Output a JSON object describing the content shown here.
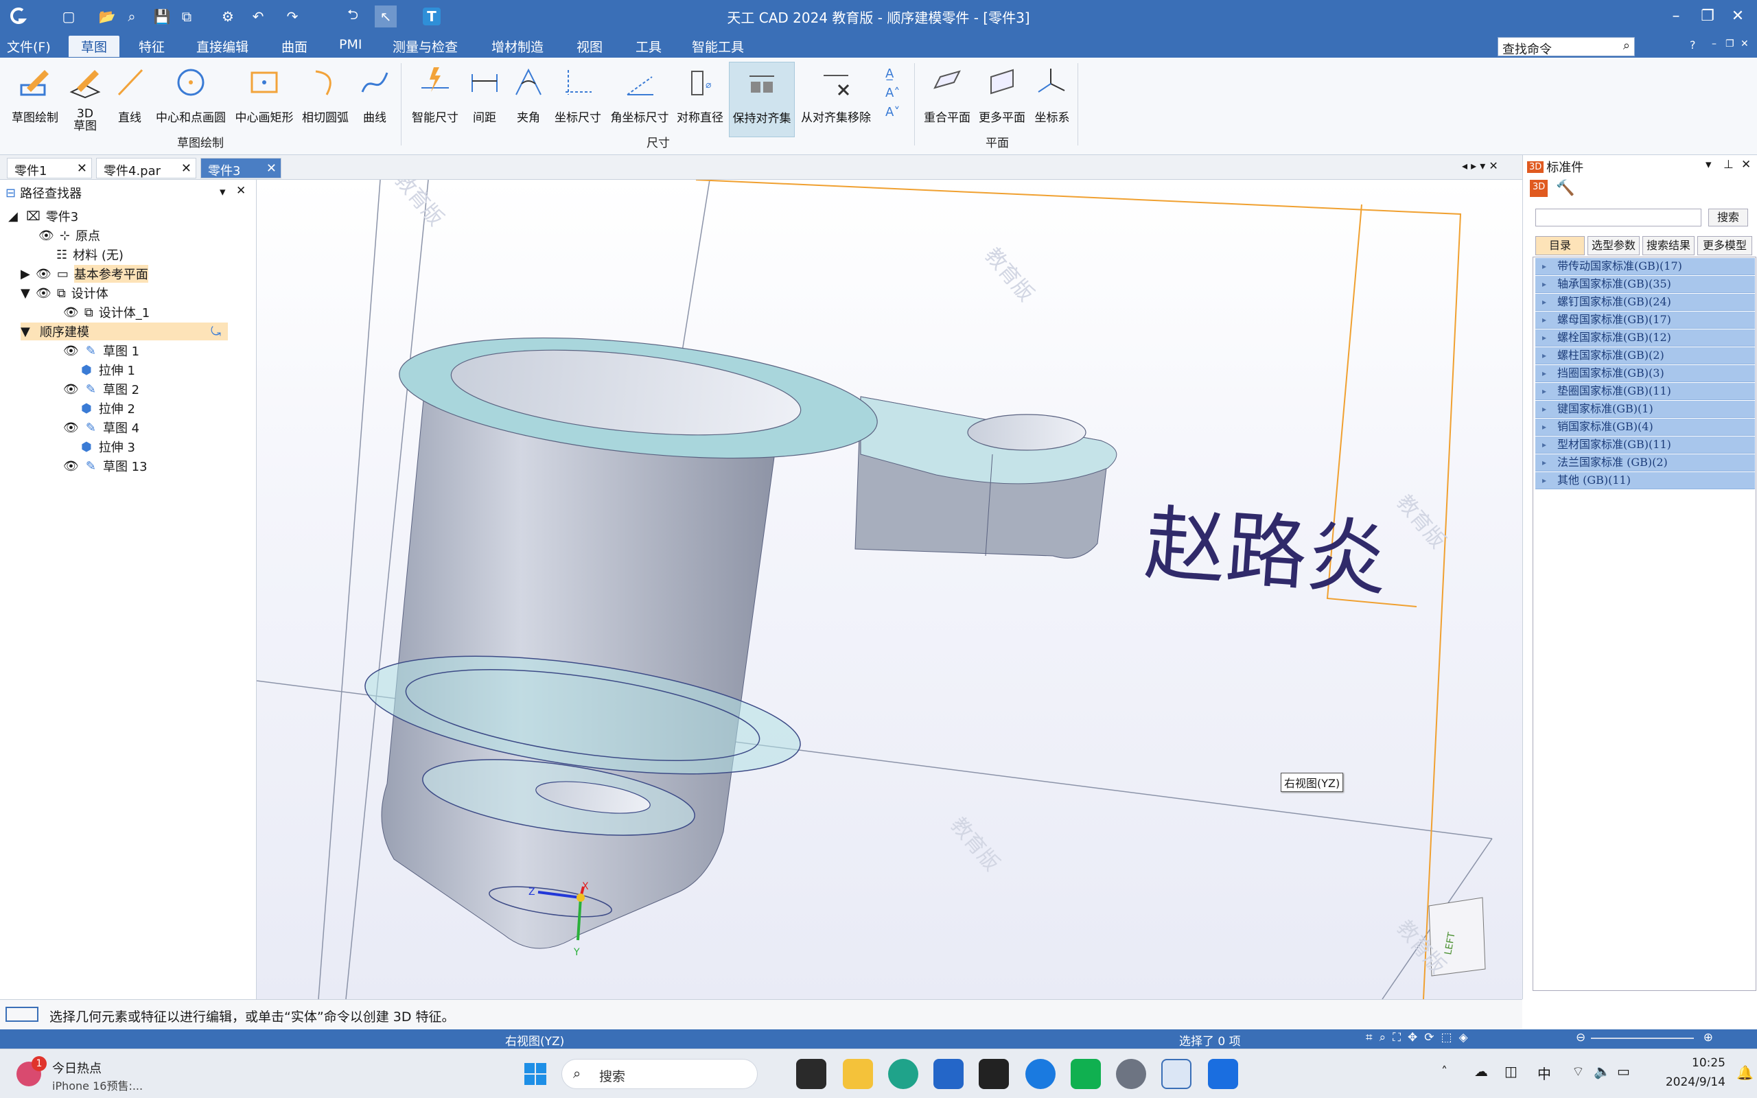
{
  "window": {
    "title": "天工 CAD 2024 教育版 - 顺序建模零件 - [零件3]"
  },
  "menubar": {
    "items": [
      "文件(F)",
      "草图",
      "特征",
      "直接编辑",
      "曲面",
      "PMI",
      "测量与检查",
      "增材制造",
      "视图",
      "工具",
      "智能工具"
    ],
    "active": "草图",
    "search_value": "查找命令",
    "help": "?"
  },
  "ribbon": {
    "sketch_group": {
      "label": "草图绘制",
      "buttons": [
        "草图绘制",
        "3D 草图",
        "直线",
        "中心和点画圆",
        "中心画矩形",
        "相切圆弧",
        "曲线"
      ]
    },
    "dimension_group": {
      "label": "尺寸",
      "buttons": [
        "智能尺寸",
        "间距",
        "夹角",
        "坐标尺寸",
        "角坐标尺寸",
        "对称直径",
        "保持对齐集",
        "从对齐集移除"
      ]
    },
    "plane_group": {
      "label": "平面",
      "buttons": [
        "重合平面",
        "更多平面",
        "坐标系"
      ]
    }
  },
  "doc_tabs": [
    "零件1",
    "零件4.par",
    "零件3"
  ],
  "active_tab": "零件3",
  "pathfinder": {
    "title": "路径查找器",
    "items": [
      "零件3",
      "原点",
      "材料 (无)",
      "基本参考平面",
      "设计体",
      "设计体_1",
      "顺序建模",
      "草图 1",
      "拉伸 1",
      "草图 2",
      "拉伸 2",
      "草图 4",
      "拉伸 3",
      "草图 13"
    ]
  },
  "viewport": {
    "annotation_text": "赵路炎",
    "view_label": "右视图(YZ)",
    "watermark": "教育版",
    "axis_labels": {
      "x": "X",
      "y": "Y",
      "z": "Z"
    },
    "cube_label": "LEFT"
  },
  "right_panel": {
    "title": "标准件",
    "search_button": "搜索",
    "tabs": [
      "目录",
      "选型参数",
      "搜索结果",
      "更多模型"
    ],
    "standards": [
      "带传动国家标准(GB)(17)",
      "轴承国家标准(GB)(35)",
      "螺钉国家标准(GB)(24)",
      "螺母国家标准(GB)(17)",
      "螺栓国家标准(GB)(12)",
      "螺柱国家标准(GB)(2)",
      "挡圈国家标准(GB)(3)",
      "垫圈国家标准(GB)(11)",
      "键国家标准(GB)(1)",
      "销国家标准(GB)(4)",
      "型材国家标准(GB)(11)",
      "法兰国家标准 (GB)(2)",
      "其他 (GB)(11)"
    ]
  },
  "status": {
    "prompt": "选择几何元素或特征以进行编辑，或单击“实体”命令以创建 3D 特征。",
    "view_name": "右视图(YZ)",
    "selection": "选择了 0 项"
  },
  "taskbar": {
    "news_title": "今日热点",
    "news_sub": "iPhone 16预售:...",
    "news_badge": "1",
    "search_placeholder": "搜索",
    "ime": "中",
    "time": "10:25",
    "date": "2024/9/14"
  },
  "colors": {
    "titlebar": "#3a6fb7",
    "part_body": "#b8c0d0",
    "part_top": "#a9d6dc",
    "annotation_text": "#302a6a",
    "plane_orange": "#f0a030"
  }
}
